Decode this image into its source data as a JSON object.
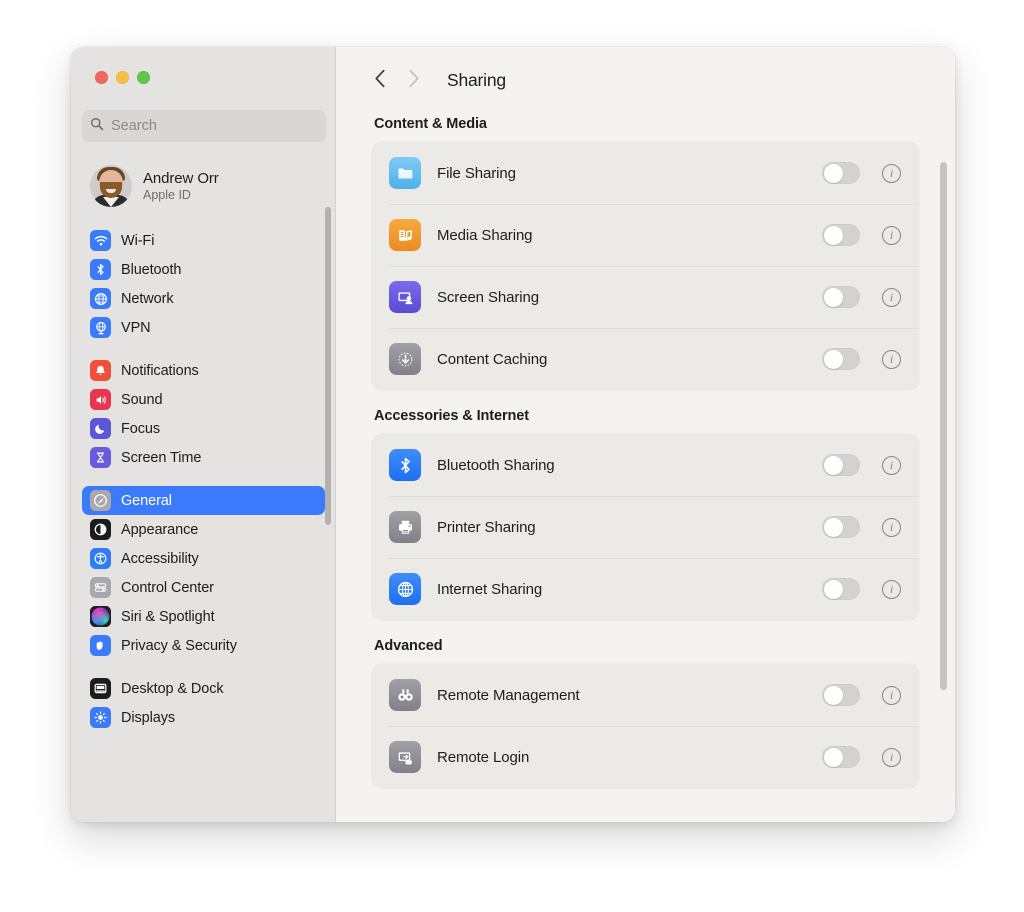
{
  "window": {
    "traffic_lights": [
      {
        "name": "close",
        "color": "#f0685f"
      },
      {
        "name": "minimize",
        "color": "#f7bd45"
      },
      {
        "name": "maximize",
        "color": "#5fc74b"
      }
    ]
  },
  "sidebar": {
    "search": {
      "value": "",
      "placeholder": "Search"
    },
    "account": {
      "name": "Andrew Orr",
      "subtitle": "Apple ID"
    },
    "groups": [
      {
        "items": [
          {
            "label": "Wi-Fi",
            "icon": "wifi-icon",
            "color": "#3a7afb",
            "selected": false
          },
          {
            "label": "Bluetooth",
            "icon": "bluetooth-icon",
            "color": "#3a7afb",
            "selected": false
          },
          {
            "label": "Network",
            "icon": "globe-icon",
            "color": "#3a7afb",
            "selected": false
          },
          {
            "label": "VPN",
            "icon": "vpn-globe-icon",
            "color": "#3a7afb",
            "selected": false
          }
        ]
      },
      {
        "items": [
          {
            "label": "Notifications",
            "icon": "bell-icon",
            "color": "#f0503a",
            "selected": false
          },
          {
            "label": "Sound",
            "icon": "speaker-icon",
            "color": "#e8364f",
            "selected": false
          },
          {
            "label": "Focus",
            "icon": "moon-icon",
            "color": "#5b57d8",
            "selected": false
          },
          {
            "label": "Screen Time",
            "icon": "hourglass-icon",
            "color": "#6a5ae0",
            "selected": false
          }
        ]
      },
      {
        "items": [
          {
            "label": "General",
            "icon": "gear-icon",
            "color": "#8e8e93",
            "selected": true
          },
          {
            "label": "Appearance",
            "icon": "appearance-icon",
            "color": "#1c1c1e",
            "selected": false
          },
          {
            "label": "Accessibility",
            "icon": "accessibility-icon",
            "color": "#2f7cf6",
            "selected": false
          },
          {
            "label": "Control Center",
            "icon": "control-center-icon",
            "color": "#8e8e93",
            "selected": false
          },
          {
            "label": "Siri & Spotlight",
            "icon": "siri-icon",
            "color": "#2b2b33",
            "selected": false
          },
          {
            "label": "Privacy & Security",
            "icon": "hand-icon",
            "color": "#3a7afb",
            "selected": false
          }
        ]
      },
      {
        "items": [
          {
            "label": "Desktop & Dock",
            "icon": "desktop-dock-icon",
            "color": "#1c1c1e",
            "selected": false
          },
          {
            "label": "Displays",
            "icon": "displays-icon",
            "color": "#3a7afb",
            "selected": false
          }
        ]
      }
    ]
  },
  "main": {
    "nav": {
      "back_label": "‹",
      "forward_label": "›"
    },
    "title": "Sharing",
    "sections": [
      {
        "title": "Content & Media",
        "rows": [
          {
            "label": "File Sharing",
            "icon": "folder-icon",
            "color": "#64bef0",
            "toggle": "off",
            "info": "info-icon"
          },
          {
            "label": "Media Sharing",
            "icon": "media-note-icon",
            "color": "#f0962e",
            "toggle": "off",
            "info": "info-icon"
          },
          {
            "label": "Screen Sharing",
            "icon": "screen-person-icon",
            "color": "#6457dd",
            "toggle": "off",
            "info": "info-icon"
          },
          {
            "label": "Content Caching",
            "icon": "download-arrow-icon",
            "color": "#8e8e93",
            "toggle": "off",
            "info": "info-icon"
          }
        ]
      },
      {
        "title": "Accessories & Internet",
        "rows": [
          {
            "label": "Bluetooth Sharing",
            "icon": "bluetooth-icon",
            "color": "#2f7cf6",
            "toggle": "off",
            "info": "info-icon"
          },
          {
            "label": "Printer Sharing",
            "icon": "printer-icon",
            "color": "#8e8e93",
            "toggle": "off",
            "info": "info-icon"
          },
          {
            "label": "Internet Sharing",
            "icon": "globe-icon",
            "color": "#2f7cf6",
            "toggle": "off",
            "info": "info-icon"
          }
        ]
      },
      {
        "title": "Advanced",
        "rows": [
          {
            "label": "Remote Management",
            "icon": "binoculars-icon",
            "color": "#8e8e93",
            "toggle": "off",
            "info": "info-icon"
          },
          {
            "label": "Remote Login",
            "icon": "remote-login-icon",
            "color": "#8e8e93",
            "toggle": "off",
            "info": "info-icon"
          }
        ]
      }
    ]
  },
  "colors": {
    "accent": "#3a7afb",
    "window_bg": "#f4f3f0",
    "sidebar_bg": "#e4e3e1",
    "card_bg": "#eceae6"
  }
}
